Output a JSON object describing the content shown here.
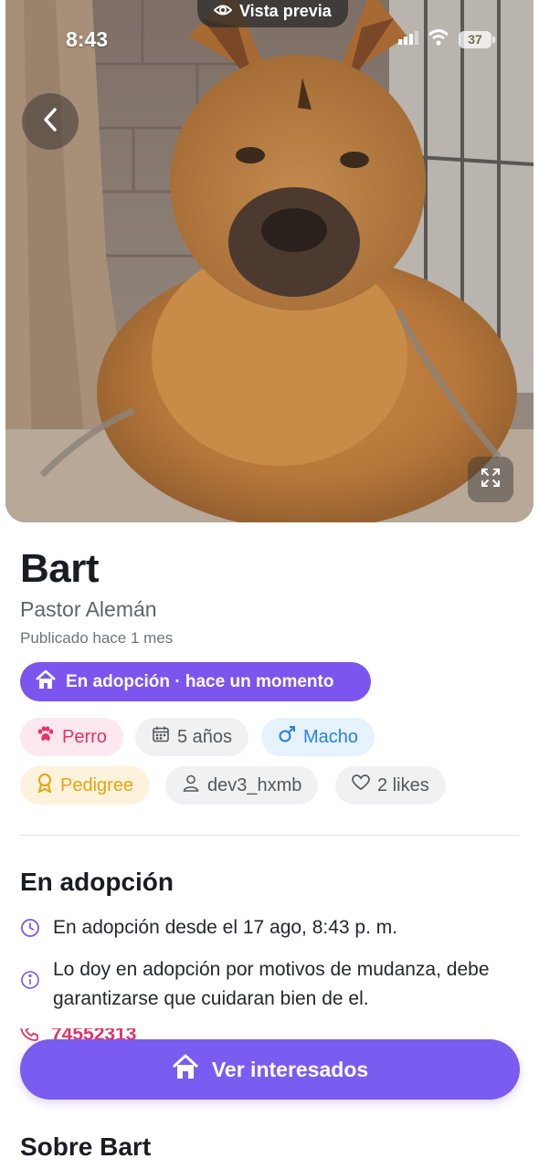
{
  "status_bar": {
    "time": "8:43",
    "battery": "37"
  },
  "preview": {
    "label": "Vista previa"
  },
  "pet": {
    "name": "Bart",
    "breed": "Pastor Alemán",
    "published": "Publicado hace 1 mes",
    "status": "En adopción · hace un momento"
  },
  "chips": {
    "species": "Perro",
    "age": "5 años",
    "sex": "Macho",
    "pedigree": "Pedigree",
    "owner": "dev3_hxmb",
    "likes": "2 likes"
  },
  "adoption": {
    "title": "En adopción",
    "since": "En adopción desde el 17 ago, 8:43 p. m.",
    "description": "Lo doy en adopción por motivos de mudanza, debe garantizarse que cuidaran bien de el.",
    "phone": "74552313"
  },
  "cta": {
    "label": "Ver interesados"
  },
  "about": {
    "title": "Sobre Bart"
  },
  "colors": {
    "accent": "#7b55ee",
    "species": "#e23366",
    "sex": "#2681e0",
    "pedigree": "#e5a512"
  },
  "icons": [
    "eye-icon",
    "chevron-left-icon",
    "expand-icon",
    "house-icon",
    "paw-icon",
    "calendar-icon",
    "male-icon",
    "award-icon",
    "user-icon",
    "heart-icon",
    "clock-icon",
    "info-icon",
    "phone-icon"
  ]
}
